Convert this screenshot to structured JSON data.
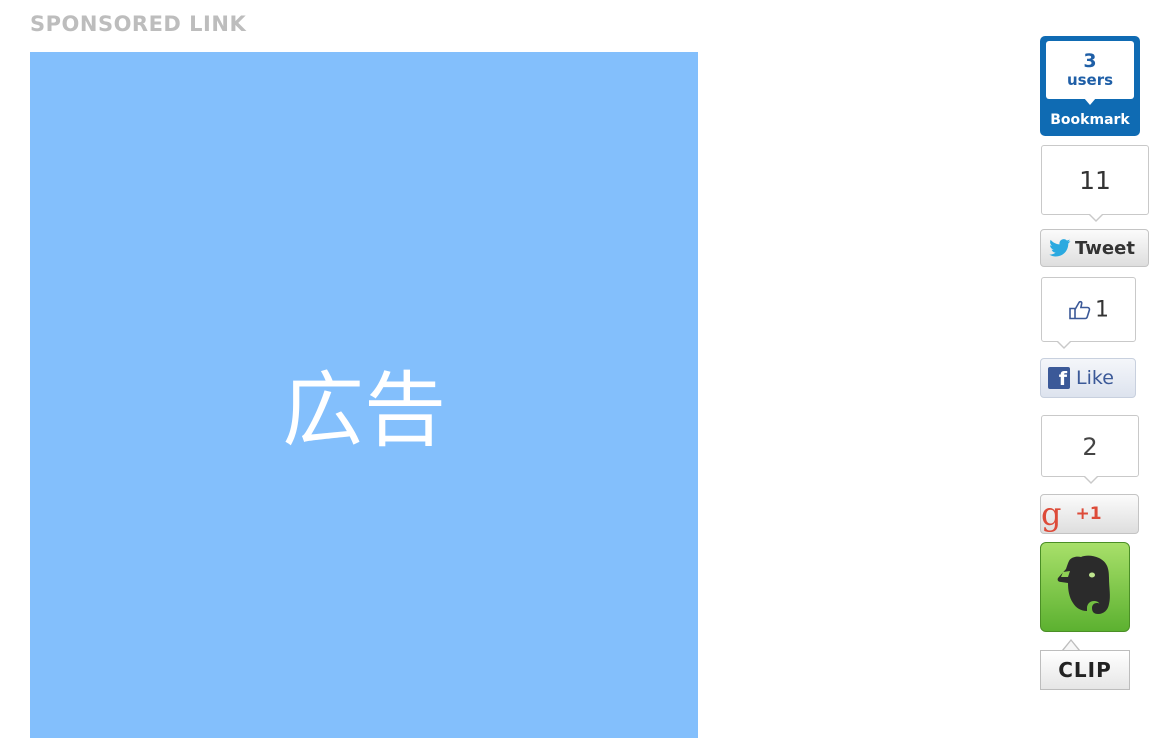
{
  "sponsored": {
    "label": "SPONSORED LINK",
    "ad_text": "広告",
    "ad_color": "#83bffc"
  },
  "share": {
    "hatena": {
      "count": "3",
      "unit": "users",
      "label": "Bookmark",
      "icon": "hatena-bookmark-icon",
      "color": "#0f6bb3"
    },
    "twitter": {
      "count": "11",
      "label": "Tweet",
      "icon": "twitter-bird-icon",
      "color": "#2aa9e0"
    },
    "facebook": {
      "count": "1",
      "label": "Like",
      "icon": "facebook-f-icon",
      "thumb_icon": "thumbs-up-icon",
      "color": "#3b5998"
    },
    "google_plus": {
      "count": "2",
      "icon": "google-g-icon",
      "label": "+1",
      "color": "#dd4b39"
    },
    "evernote": {
      "icon": "evernote-elephant-icon",
      "label": "CLIP",
      "color": "#5cb130"
    }
  }
}
